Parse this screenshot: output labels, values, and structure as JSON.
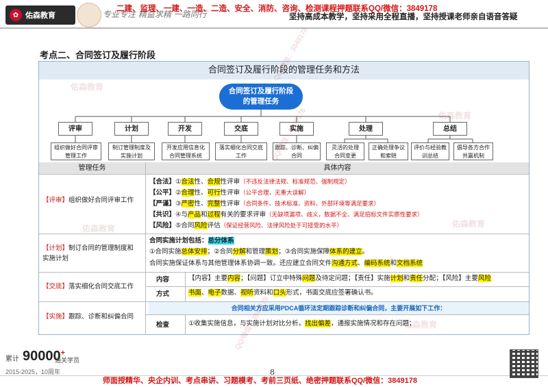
{
  "header": {
    "logo_text": "佑森教育",
    "signature_text": "专业专注 精益求精 一路同行",
    "tagline_red": "二建、监理、一建、一造、二造、安全、消防、咨询、检测课程押题联系QQ/微信：3849178",
    "tagline_black": "坚持高成本教学，坚持采用全程直播，坚持授课老师亲自语音答疑"
  },
  "section_title": "考点二、合同签订及履行阶段",
  "table_title": "合同签订及履行阶段的管理任务和方法",
  "root_node": [
    "合同签订及履行阶段",
    "的管理任务"
  ],
  "stages": [
    {
      "label": "评审",
      "tasks": [
        [
          "组织做好合同评审",
          "管理工作"
        ]
      ]
    },
    {
      "label": "计划",
      "tasks": [
        [
          "制订管理制度及",
          "实施计划"
        ]
      ]
    },
    {
      "label": "开发",
      "tasks": [
        [
          "开发应用信息化",
          "合同管理系统"
        ]
      ]
    },
    {
      "label": "交底",
      "tasks": [
        [
          "落实细化合同交底",
          "工作"
        ]
      ]
    },
    {
      "label": "实施",
      "tasks": [
        [
          "跟踪、诊断、纠偏",
          "合同"
        ]
      ]
    },
    {
      "label": "处理",
      "tasks": [
        [
          "灵活的处理",
          "合同变更"
        ],
        [
          "正确处理争议",
          "和索赔"
        ]
      ]
    },
    {
      "label": "总结",
      "tasks": [
        [
          "评价与经验教",
          "训总结"
        ],
        [
          "倡导各方合作",
          "共赢机制"
        ]
      ]
    }
  ],
  "table": {
    "col_task": "管理任务",
    "col_content": "具体内容",
    "rows": {
      "review": {
        "tag": "【评审】",
        "task": "组织做好合同评审工作",
        "lines": [
          {
            "key": "【合法】",
            "a": "①",
            "b": "合法",
            "c": "性、",
            "d": "合规",
            "e": "性评审",
            "note": "（不违反法律法规、标准规范、强制规定）"
          },
          {
            "key": "【公平】",
            "a": "②",
            "b": "合理",
            "c": "性、",
            "d": "可行",
            "e": "性评审",
            "note": "（公平合理，无重大误解）"
          },
          {
            "key": "【严谨】",
            "a": "③",
            "b": "严密",
            "c": "性、",
            "d": "完整",
            "e": "性评审",
            "note": "（合同条件、技术标准、资料、外部环境等满足要求）"
          },
          {
            "key": "【共识】",
            "a": "④与",
            "b": "产品",
            "c": "和",
            "d": "过程",
            "e": "有关的要求评审",
            "note": "（无缺项漏项、歧义，数据不全、满足招标文件实质性要求）"
          },
          {
            "key": "【风险】",
            "a": "⑤合同",
            "b": "风险",
            "c": "",
            "d": "",
            "e": "评估",
            "note": "（保证经营风险、法律风险处于可接受的水平）"
          }
        ]
      },
      "plan": {
        "tag": "【计划】",
        "task_lines": [
          "制订合同的管理制度和",
          "实施计划"
        ],
        "heading": "合同实施计划包括：",
        "heading_hl": "总分体系",
        "line2": {
          "p1": "①合同实施",
          "h1": "总体安排",
          "p2": "；②合同",
          "h2": "分解",
          "p3": "和管理",
          "h3": "策划",
          "p4": "；③合同实施保障",
          "h4": "体系的建立",
          "p5": "。"
        },
        "line3": {
          "p1": "合同实施保证体系与其他管理体系协调一致。还应建立合同文件",
          "h1": "沟通方式",
          "p2": "、",
          "h2": "编码系统",
          "p3": "和",
          "h3": "文档系统"
        }
      },
      "handover": {
        "tag": "【交底】",
        "task": "落实细化合同交底工作",
        "content_label": "内容",
        "method_label": "方式",
        "content_line": {
          "p1": "【内容】主要",
          "h1": "内容",
          "p2": "；【问题】订立中特殊",
          "h2": "问题",
          "p3": "及待定问题；【责任】实施",
          "h3": "计划",
          "p4": "和",
          "h4": "责任",
          "p5": "分配；【风险】主要",
          "h5": "风险"
        },
        "method_line": {
          "h1": "书面",
          "p1": "、",
          "h2": "电子",
          "p2": "数据、",
          "h3": "视听",
          "p3": "资料和",
          "h4": "口头",
          "p4": "形式，书面交底应签署确认书。"
        }
      },
      "implementation": {
        "tag": "【实施】",
        "task": "跟踪、诊断和纠偏合同",
        "banner": "合同相关方应采用PDCA循环法定期跟踪诊断和纠偏合同，主要开展如下工作：",
        "check_label": "检查",
        "check_line": {
          "p1": "①收集实施信息，与实施计划对比分析，",
          "h1": "找出偏差",
          "p2": "，通报实施情况和存在问题；"
        }
      }
    }
  },
  "watermarks": [
    "佑森教育",
    "佑森教育",
    "佑森教育",
    "佑森教育",
    "佑森教育",
    "QQ/微信：3849178",
    "QQ/微信：3849178",
    "QQ/微信：3849178"
  ],
  "footer": {
    "stats_prefix": "累计",
    "stats_number": "90000",
    "stats_plus": "+",
    "stats_suffix": "通关学员",
    "years": "2015-2025，10周年",
    "page_number": "8",
    "bottom_text": "师面授精华、央企内训、考点串讲、习题模考、考前三页纸、绝密押题联系QQ/微信：3849178"
  }
}
